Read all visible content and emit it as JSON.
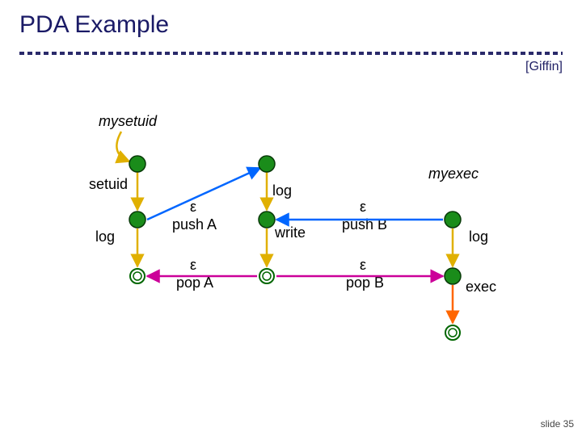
{
  "title": "PDA Example",
  "attribution": "[Giffin]",
  "slide_number": "slide 35",
  "labels": {
    "mysetuid": "mysetuid",
    "myexec": "myexec",
    "setuid": "setuid",
    "log_left": "log",
    "log_top": "log",
    "write": "write",
    "log_right": "log",
    "exec": "exec",
    "pushA_eps": "ε",
    "pushA_txt": "push A",
    "popA_eps": "ε",
    "popA_txt": "pop A",
    "pushB_eps": "ε",
    "pushB_txt": "push B",
    "popB_eps": "ε",
    "popB_txt": "pop B"
  },
  "colors": {
    "indigo": "#1a1a66",
    "green_fill": "#1a8c1a",
    "green_stroke": "#083a08",
    "yellow": "#ffcc00",
    "orange": "#ff6600",
    "blue": "#0066ff",
    "magenta": "#cc0099",
    "open_stroke": "#006600"
  },
  "chart_data": {
    "type": "diagram",
    "title": "PDA call/return graph",
    "functions": [
      "mysetuid",
      "myexec"
    ],
    "nodes": [
      {
        "id": "s_entry",
        "fn": "mysetuid",
        "kind": "entry"
      },
      {
        "id": "s1",
        "fn": "mysetuid",
        "kind": "call",
        "label": "setuid"
      },
      {
        "id": "s2",
        "fn": "mysetuid",
        "kind": "call",
        "label": "log"
      },
      {
        "id": "s3",
        "fn": "mysetuid",
        "kind": "return"
      },
      {
        "id": "m1",
        "fn": "myexec",
        "kind": "call",
        "label": "log"
      },
      {
        "id": "m2",
        "fn": "myexec",
        "kind": "call",
        "label": "write"
      },
      {
        "id": "m3",
        "fn": "myexec",
        "kind": "return"
      },
      {
        "id": "e_entry",
        "fn": "myexec",
        "kind": "entry"
      },
      {
        "id": "e1",
        "fn": "myexec",
        "kind": "call",
        "label": "log"
      },
      {
        "id": "e2",
        "fn": "myexec",
        "kind": "call",
        "label": "exec"
      },
      {
        "id": "exit",
        "fn": "",
        "kind": "exit"
      }
    ],
    "edges": [
      {
        "from": "s_entry",
        "to": "s1",
        "label": ""
      },
      {
        "from": "s1",
        "to": "s2",
        "label": "setuid"
      },
      {
        "from": "s2",
        "to": "s3",
        "label": "log"
      },
      {
        "from": "s2",
        "to": "m1",
        "label": "ε push A",
        "kind": "call_push"
      },
      {
        "from": "m3",
        "to": "s3",
        "label": "ε pop A",
        "kind": "return_pop"
      },
      {
        "from": "m1",
        "to": "m2",
        "label": "log"
      },
      {
        "from": "m2",
        "to": "m3",
        "label": "write"
      },
      {
        "from": "e_entry",
        "to": "e1",
        "label": ""
      },
      {
        "from": "e1",
        "to": "e2",
        "label": "log"
      },
      {
        "from": "e2",
        "to": "exit",
        "label": "exec"
      },
      {
        "from": "e1",
        "to": "m2",
        "label": "ε push B",
        "kind": "call_push"
      },
      {
        "from": "m3",
        "to": "e2",
        "label": "ε pop B",
        "kind": "return_pop"
      }
    ]
  }
}
